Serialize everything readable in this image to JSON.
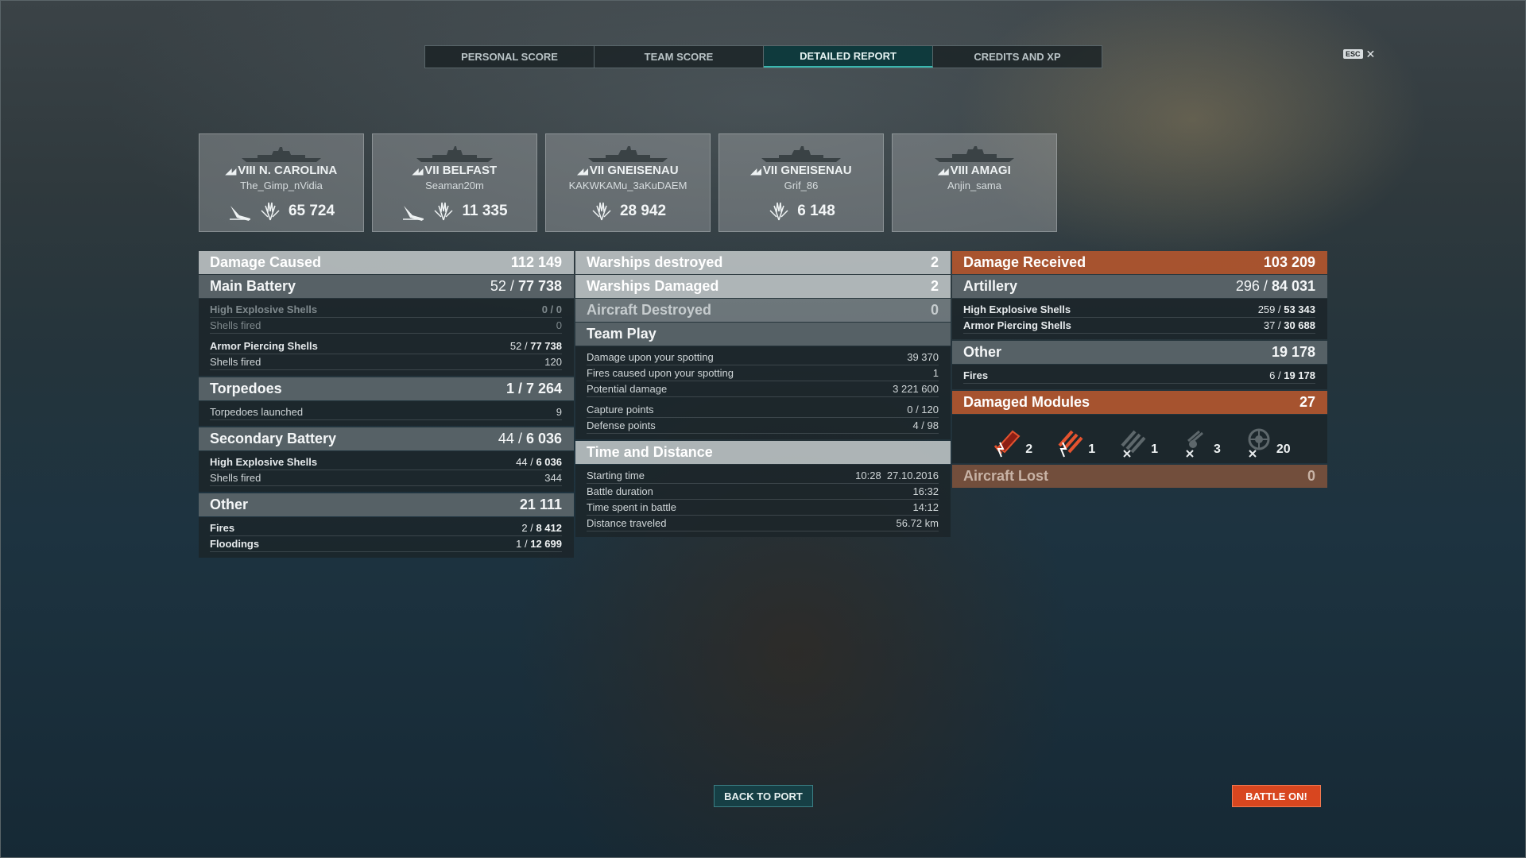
{
  "tabs": [
    {
      "label": "PERSONAL SCORE"
    },
    {
      "label": "TEAM SCORE"
    },
    {
      "label": "DETAILED REPORT",
      "active": true
    },
    {
      "label": "CREDITS AND XP"
    }
  ],
  "esc": {
    "key": "ESC",
    "close": "✕"
  },
  "ships": [
    {
      "tier_ship": "VIII N. CAROLINA",
      "player": "The_Gimp_nVidia",
      "damage": "65 724",
      "kill_icon": "torpedo-hit-icon"
    },
    {
      "tier_ship": "VII BELFAST",
      "player": "Seaman20m",
      "damage": "11 335",
      "kill_icon": "torpedo-hit-icon"
    },
    {
      "tier_ship": "VII GNEISENAU",
      "player": "KAKWKAMu_3aKuDAEM",
      "damage": "28 942"
    },
    {
      "tier_ship": "VII GNEISENAU",
      "player": "Grif_86",
      "damage": "6 148"
    },
    {
      "tier_ship": "VIII AMAGI",
      "player": "Anjin_sama"
    }
  ],
  "damage_caused": {
    "title": "Damage Caused",
    "total": "112 149",
    "main_battery": {
      "title": "Main Battery",
      "hits": "52",
      "dmg": "77 738"
    },
    "he_block": {
      "he_label": "High Explosive Shells",
      "he_value": "0 / 0",
      "fired_label": "Shells fired",
      "fired_value": "0"
    },
    "ap_block": {
      "ap_label": "Armor Piercing Shells",
      "ap_hits": "52",
      "ap_dmg": "77 738",
      "fired_label": "Shells fired",
      "fired_value": "120"
    },
    "torpedoes": {
      "title": "Torpedoes",
      "value": "1 / 7 264",
      "launched_label": "Torpedoes launched",
      "launched_value": "9"
    },
    "secondary": {
      "title": "Secondary Battery",
      "hits": "44",
      "dmg": "6 036",
      "he_label": "High Explosive Shells",
      "he_hits": "44",
      "he_dmg": "6 036",
      "fired_label": "Shells fired",
      "fired_value": "344"
    },
    "other": {
      "title": "Other",
      "value": "21 111",
      "fires_label": "Fires",
      "fires_hits": "2",
      "fires_dmg": "8 412",
      "flood_label": "Floodings",
      "flood_hits": "1",
      "flood_dmg": "12 699"
    }
  },
  "middle": {
    "warships_destroyed": {
      "label": "Warships destroyed",
      "value": "2"
    },
    "warships_damaged": {
      "label": "Warships Damaged",
      "value": "2"
    },
    "aircraft_destroyed": {
      "label": "Aircraft Destroyed",
      "value": "0"
    },
    "team_play": {
      "title": "Team Play",
      "rows": [
        {
          "label": "Damage upon your spotting",
          "value": "39 370"
        },
        {
          "label": "Fires caused upon your spotting",
          "value": "1"
        },
        {
          "label": "Potential damage",
          "value": "3 221 600"
        },
        {
          "label": "Capture points",
          "value": "0 / 120"
        },
        {
          "label": "Defense points",
          "value": "4 / 98"
        }
      ]
    },
    "time": {
      "title": "Time and Distance",
      "rows": [
        {
          "label": "Starting time",
          "value": "10:28  27.10.2016"
        },
        {
          "label": "Battle duration",
          "value": "16:32"
        },
        {
          "label": "Time spent in battle",
          "value": "14:12"
        },
        {
          "label": "Distance traveled",
          "value": "56.72 km"
        }
      ]
    }
  },
  "damage_received": {
    "title": "Damage Received",
    "total": "103 209",
    "artillery": {
      "title": "Artillery",
      "hits": "296",
      "dmg": "84 031",
      "he_label": "High Explosive Shells",
      "he_hits": "259",
      "he_dmg": "53 343",
      "ap_label": "Armor Piercing Shells",
      "ap_hits": "37",
      "ap_dmg": "30 688"
    },
    "other": {
      "title": "Other",
      "value": "19 178",
      "fires_label": "Fires",
      "fires_hits": "6",
      "fires_dmg": "19 178"
    },
    "modules": {
      "title": "Damaged Modules",
      "value": "27",
      "items": [
        {
          "icon": "main-battery-damaged-icon",
          "count": "2"
        },
        {
          "icon": "secondary-battery-damaged-icon",
          "count": "1"
        },
        {
          "icon": "torpedo-tubes-destroyed-icon",
          "count": "1"
        },
        {
          "icon": "aa-gun-destroyed-icon",
          "count": "3"
        },
        {
          "icon": "aa-mount-destroyed-icon",
          "count": "20"
        }
      ]
    },
    "aircraft_lost": {
      "label": "Aircraft Lost",
      "value": "0"
    }
  },
  "buttons": {
    "back": "BACK TO PORT",
    "battle": "BATTLE ON!"
  },
  "colors": {
    "accent_teal": "#38b8b0",
    "received_orange": "#b2562e",
    "battle_button": "#d8461f"
  }
}
